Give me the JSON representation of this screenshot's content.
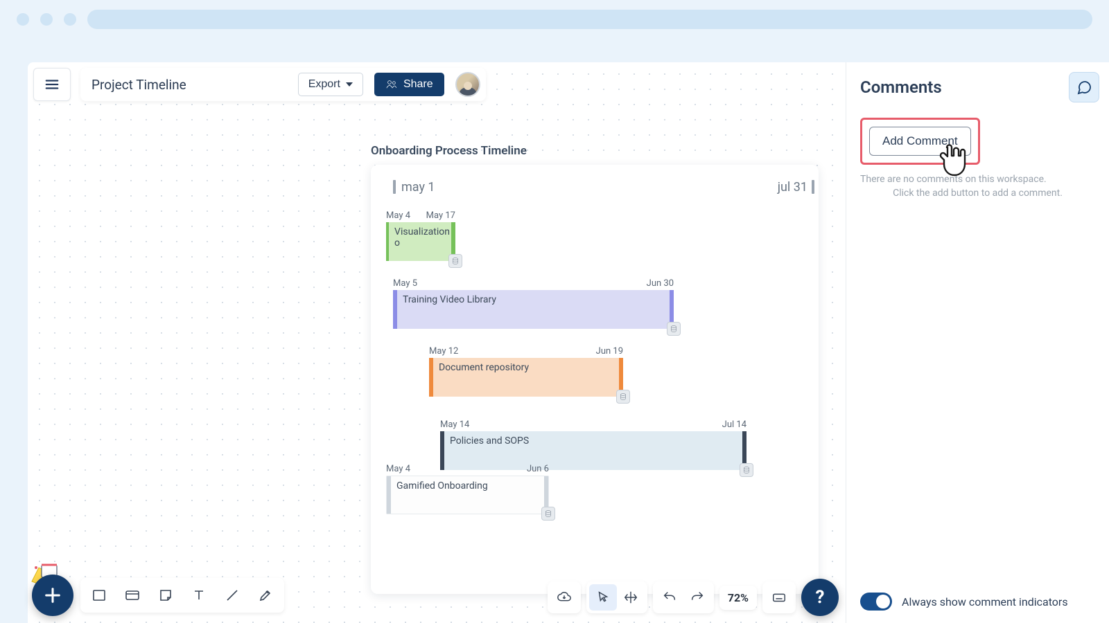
{
  "header": {
    "title": "Project Timeline",
    "export_label": "Export",
    "share_label": "Share"
  },
  "timeline": {
    "title": "Onboarding Process Timeline",
    "axis_start": "may 1",
    "axis_end": "jul 31",
    "bars": [
      {
        "start": "May 4",
        "end": "May 17",
        "label": "Visualization o"
      },
      {
        "start": "May 5",
        "end": "Jun 30",
        "label": "Training Video Library"
      },
      {
        "start": "May 12",
        "end": "Jun 19",
        "label": "Document repository"
      },
      {
        "start": "May 14",
        "end": "Jul 14",
        "label": "Policies and SOPS"
      },
      {
        "start": "May 4",
        "end": "Jun 6",
        "label": "Gamified Onboarding"
      }
    ]
  },
  "sidebar": {
    "title": "Comments",
    "add_comment_label": "Add Comment",
    "empty_line1": "There are no comments on this workspace.",
    "empty_line2": "Click the add button to add a comment.",
    "toggle_label": "Always show comment indicators"
  },
  "footer": {
    "zoom": "72%",
    "help": "?"
  }
}
